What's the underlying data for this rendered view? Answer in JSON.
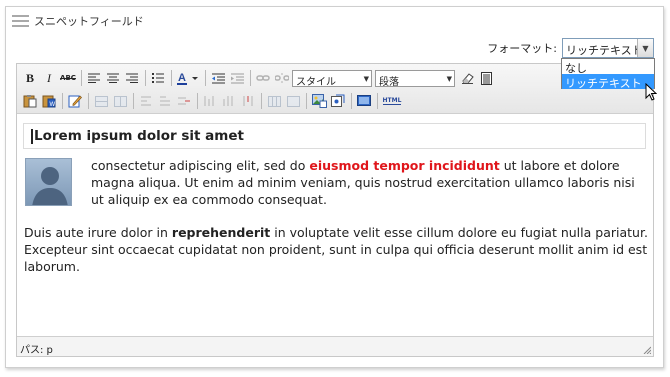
{
  "panel": {
    "title": "スニペットフィールド"
  },
  "format": {
    "label": "フォーマット:",
    "selected": "リッチテキスト",
    "options": [
      "なし",
      "リッチテキスト"
    ]
  },
  "toolbar": {
    "bold": "B",
    "italic": "I",
    "strike": "ABC",
    "style_select": "スタイル",
    "paragraph_select": "段落",
    "html_button": "HTML"
  },
  "content": {
    "heading": "Lorem ipsum dolor sit amet",
    "p1_before": "consectetur adipiscing elit, sed do ",
    "p1_red": "eiusmod tempor incididunt",
    "p1_after": " ut labore et dolore magna aliqua. Ut enim ad minim veniam, quis nostrud exercitation ullamco laboris nisi ut aliquip ex ea commodo consequat.",
    "p2_before": "Duis aute irure dolor in ",
    "p2_bold": "reprehenderit",
    "p2_after": " in voluptate velit esse cillum dolore eu fugiat nulla pariatur. Excepteur sint occaecat cupidatat non proident, sunt in culpa qui officia deserunt mollit anim id est laborum."
  },
  "status": {
    "path": "パス: p"
  },
  "colors": {
    "highlight": "#3399ff",
    "red_text": "#e0161b"
  }
}
